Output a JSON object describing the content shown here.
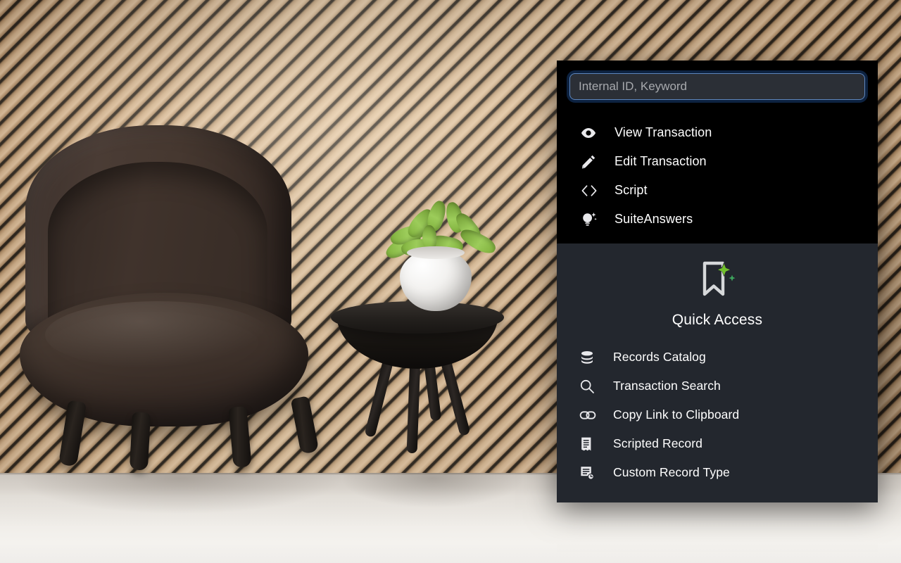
{
  "background": {
    "scene_description": "interior-room-photo",
    "wall": "diagonal-wood-slat-wall",
    "floor": "glossy-light-floor",
    "furniture": [
      "dark-brown-armchair",
      "black-side-table",
      "green-succulent-in-white-pot"
    ]
  },
  "panel": {
    "name": "Quick Access",
    "search": {
      "placeholder": "Internal ID, Keyword",
      "value": ""
    },
    "top_menu": [
      {
        "icon": "eye-icon",
        "label": "View Transaction"
      },
      {
        "icon": "pencil-icon",
        "label": "Edit Transaction"
      },
      {
        "icon": "code-brackets-icon",
        "label": "Script"
      },
      {
        "icon": "lightbulb-sparkle-icon",
        "label": "SuiteAnswers"
      }
    ],
    "brand": {
      "logo_icon": "bookmark-sparkle-logo",
      "title": "Quick Access"
    },
    "bottom_menu": [
      {
        "icon": "database-stack-icon",
        "label": "Records Catalog"
      },
      {
        "icon": "search-magnifier-icon",
        "label": "Transaction Search"
      },
      {
        "icon": "link-chain-icon",
        "label": "Copy Link to Clipboard"
      },
      {
        "icon": "document-script-icon",
        "label": "Scripted Record"
      },
      {
        "icon": "custom-record-icon",
        "label": "Custom Record Type"
      }
    ]
  },
  "colors": {
    "panel_top_bg": "#000000",
    "panel_bottom_bg": "#23272e",
    "input_bg": "#2b2f36",
    "input_border": "#5d86bd",
    "focus_ring": "#0d2240",
    "text": "#ffffff",
    "placeholder": "#a7a9ad",
    "accent_green": "#72c02c",
    "logo_gray": "#d6d8da"
  }
}
